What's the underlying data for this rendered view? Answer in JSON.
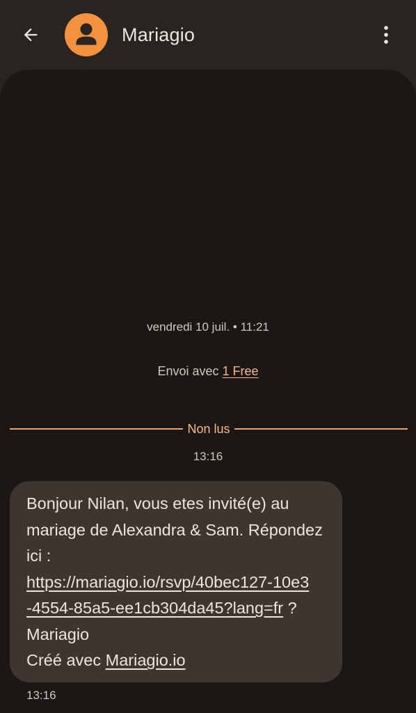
{
  "header": {
    "contact_name": "Mariagio",
    "back_icon": "arrow-back-icon",
    "avatar_icon": "person-avatar-icon",
    "menu_icon": "more-vert-icon",
    "avatar_color": "#f2923f"
  },
  "thread": {
    "date_header": "vendredi 10 juil. • 11:21",
    "sim_prefix": "Envoi avec ",
    "sim_name": "1 Free",
    "unread_label": "Non lus",
    "unread_time": "13:16",
    "accent_color": "#f4b98a"
  },
  "message": {
    "line1": "Bonjour Nilan, vous etes invité(e) au",
    "line2": "mariage de Alexandra & Sam. Répondez",
    "line3": "ici :",
    "link_part1": "https://mariagio.io/rsvp/40bec127-10e3",
    "link_part2": "-4554-85a5-ee1cb304da45?lang=fr",
    "after_link": " ?",
    "line6": "Mariagio",
    "signature_prefix": "Créé avec ",
    "signature_link": "Mariagio.io",
    "time": "13:16"
  }
}
